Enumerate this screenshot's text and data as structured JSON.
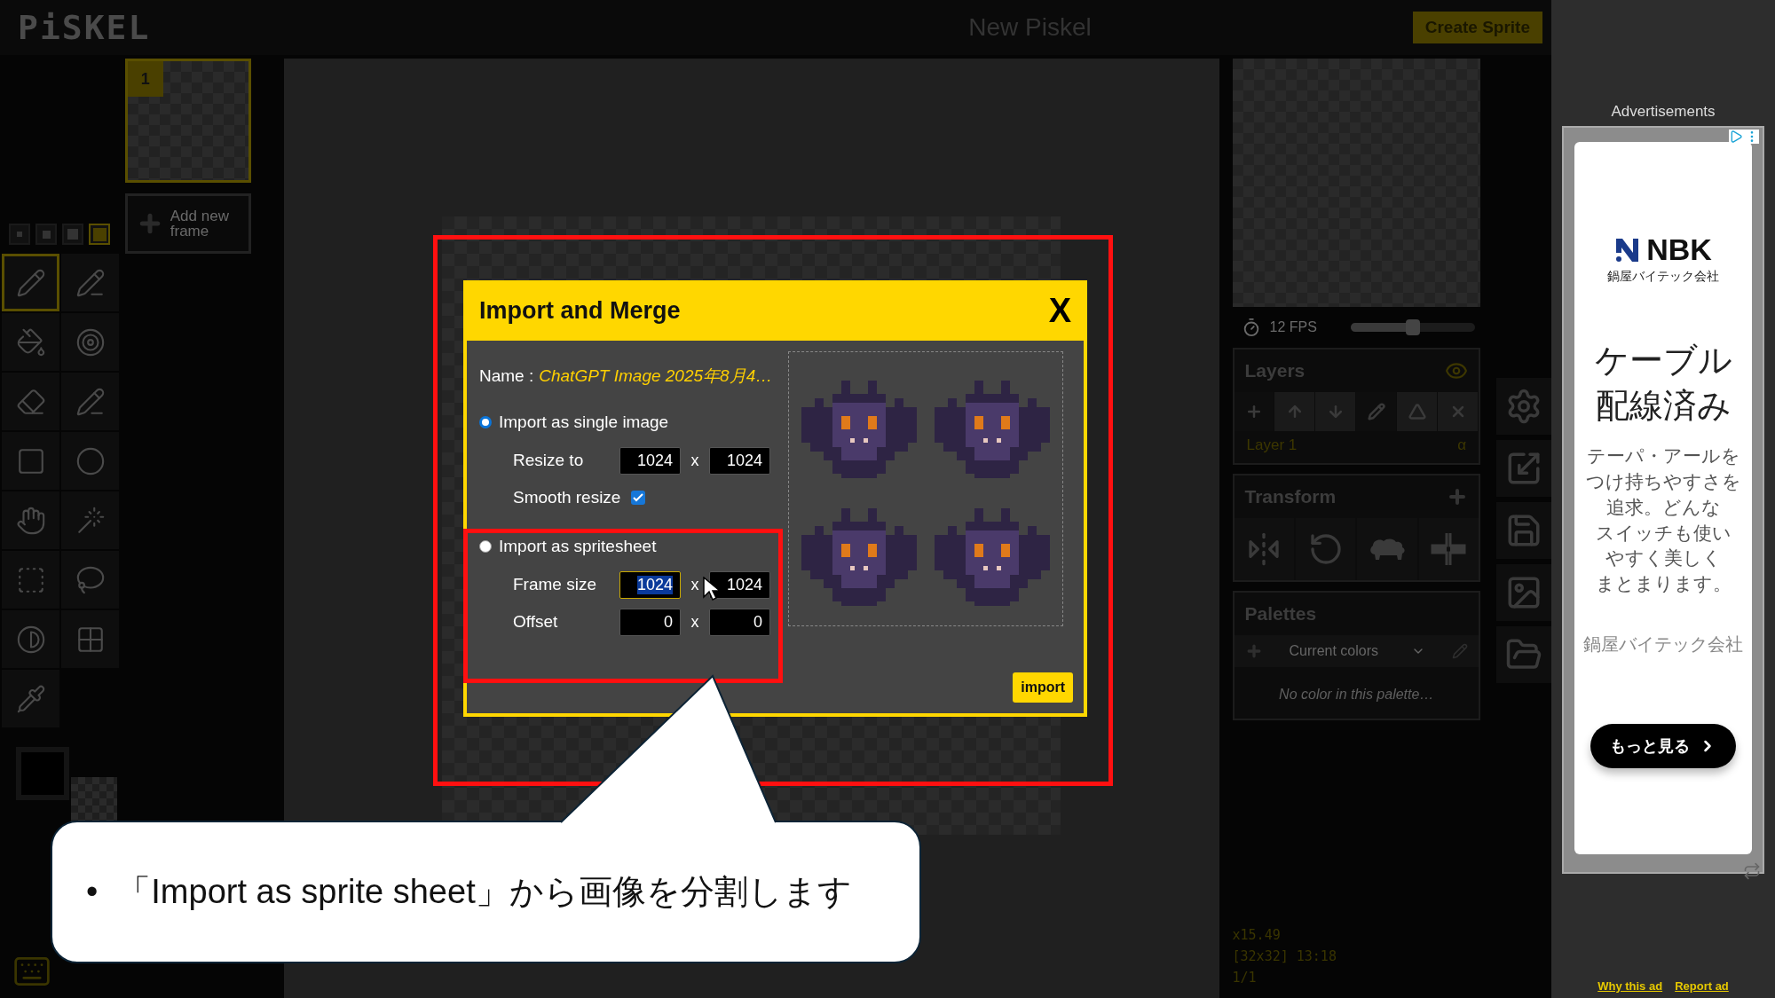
{
  "header": {
    "logo": "PiSKEL",
    "title": "New Piskel",
    "create_button": "Create Sprite"
  },
  "pen_sizes": [
    {
      "selected": false
    },
    {
      "selected": false
    },
    {
      "selected": false
    },
    {
      "selected": true
    }
  ],
  "tools": [
    {
      "kind": "pen",
      "selected": true
    },
    {
      "kind": "mirror",
      "selected": false
    },
    {
      "kind": "bucket",
      "selected": false
    },
    {
      "kind": "target",
      "selected": false
    },
    {
      "kind": "eraser",
      "selected": false
    },
    {
      "kind": "stroke",
      "selected": false
    },
    {
      "kind": "rectangle",
      "selected": false
    },
    {
      "kind": "ellipse",
      "selected": false
    },
    {
      "kind": "hand",
      "selected": false
    },
    {
      "kind": "wand",
      "selected": false
    },
    {
      "kind": "rect-select",
      "selected": false
    },
    {
      "kind": "lasso",
      "selected": false
    },
    {
      "kind": "lighten",
      "selected": false
    },
    {
      "kind": "dither",
      "selected": false
    },
    {
      "kind": "picker",
      "selected": false
    }
  ],
  "frames": [
    {
      "number": "1",
      "selected": true
    }
  ],
  "add_frame": "Add new frame",
  "preview": {
    "fps": "12 FPS",
    "level": 0.5
  },
  "layers": {
    "title": "Layers",
    "items": [
      {
        "name": "Layer 1",
        "alpha": "α",
        "selected": true
      }
    ]
  },
  "transform": {
    "title": "Transform"
  },
  "palettes": {
    "title": "Palettes",
    "select": "Current colors",
    "empty": "No color in this palette…"
  },
  "status": [
    "x15.49",
    "[32x32] 13:18",
    "1/1"
  ],
  "dialog": {
    "title": "Import and Merge",
    "close": "X",
    "name_label": "Name :",
    "name_value": "ChatGPT Image 2025年8月4…",
    "options": [
      {
        "label": "Import as single image",
        "selected": true,
        "rows": [
          {
            "kind": "pair",
            "label": "Resize to",
            "values": [
              {
                "text": "1024",
                "highlighted": false
              },
              {
                "text": "1024",
                "highlighted": false
              }
            ],
            "separator": "x"
          },
          {
            "kind": "checkbox",
            "label": "Smooth resize",
            "checked": true
          }
        ]
      },
      {
        "label": "Import as spritesheet",
        "selected": false,
        "rows": [
          {
            "kind": "pair",
            "label": "Frame size",
            "values": [
              {
                "text": "1024",
                "highlighted": true
              },
              {
                "text": "1024",
                "highlighted": false
              }
            ],
            "separator": "x"
          },
          {
            "kind": "pair",
            "label": "Offset",
            "values": [
              {
                "text": "0",
                "highlighted": false
              },
              {
                "text": "0",
                "highlighted": false
              }
            ],
            "separator": "x"
          }
        ]
      }
    ],
    "import_button": "import"
  },
  "callout": {
    "bullet": "•",
    "text": "「Import as sprite sheet」から画像を分割します"
  },
  "ad": {
    "header": "Advertisements",
    "brand": "NBK",
    "brand_sub": "鍋屋バイテック会社",
    "headline": [
      "ケーブル",
      "配線済み"
    ],
    "body": [
      "テーパ・アールを",
      "つけ持ちやすさを",
      "追求。どんな",
      "スイッチも使い",
      "やすく美しく",
      "まとまります。"
    ],
    "advertiser": "鍋屋バイテック会社",
    "cta": "もっと見る",
    "links": [
      "Why this ad",
      "Report ad"
    ]
  }
}
